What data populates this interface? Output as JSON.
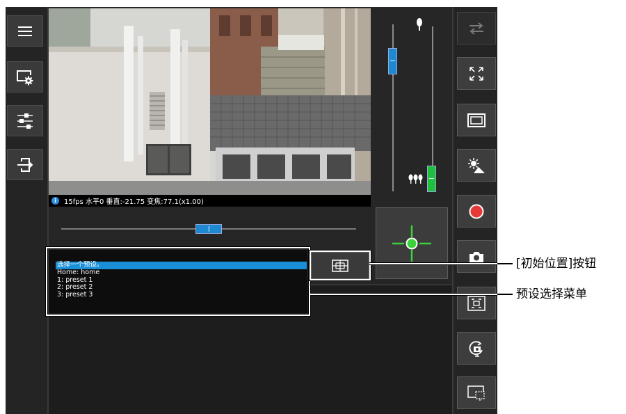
{
  "left_sidebar": {
    "buttons": [
      {
        "icon": "menu-icon"
      },
      {
        "icon": "settings-icon"
      },
      {
        "icon": "sliders-icon"
      },
      {
        "icon": "exit-icon"
      }
    ]
  },
  "video": {
    "status_icon": "info-icon",
    "status_icon_glyph": "i",
    "status_text": "15fps 水平0 垂直:-21.75 变焦:77.1(x1.00)"
  },
  "tilt_slider": {
    "level": 0.22
  },
  "zoom_slider": {
    "level": 0.92,
    "tele_icon": "single-tree-icon",
    "wide_icon": "three-trees-icon"
  },
  "pan_slider": {
    "level": 0.5
  },
  "center_button": {
    "icon": "crosshair-icon"
  },
  "home_button": {
    "icon": "home-position-grid-icon"
  },
  "preset_menu": {
    "options": [
      "选择一个预设。",
      "Home: home",
      "1: preset 1",
      "2: preset 2",
      "3: preset 3"
    ],
    "selected_index": 0
  },
  "right_toolbar": {
    "buttons": [
      {
        "icon": "swap-icon",
        "enabled": false
      },
      {
        "icon": "fullscreen-icon",
        "enabled": true
      },
      {
        "icon": "window-icon",
        "enabled": true
      },
      {
        "icon": "scene-icon",
        "enabled": true
      },
      {
        "icon": "record-icon",
        "enabled": true
      },
      {
        "icon": "camera-icon",
        "enabled": true
      },
      {
        "icon": "focus-frame-icon",
        "enabled": true
      },
      {
        "icon": "ptz-rotate-icon",
        "enabled": true
      },
      {
        "icon": "image-size-icon",
        "enabled": true
      }
    ]
  },
  "callouts": {
    "home_button_label": "[初始位置]按钮",
    "preset_menu_label": "预设选择菜单"
  },
  "colors": {
    "selection": "#1a8fd8",
    "tilt_thumb": "#1e88d0",
    "pan_thumb": "#1e88d0",
    "zoom_thumb": "#1ec03c",
    "crosshair": "#3bd23b",
    "record": "#e53935"
  }
}
